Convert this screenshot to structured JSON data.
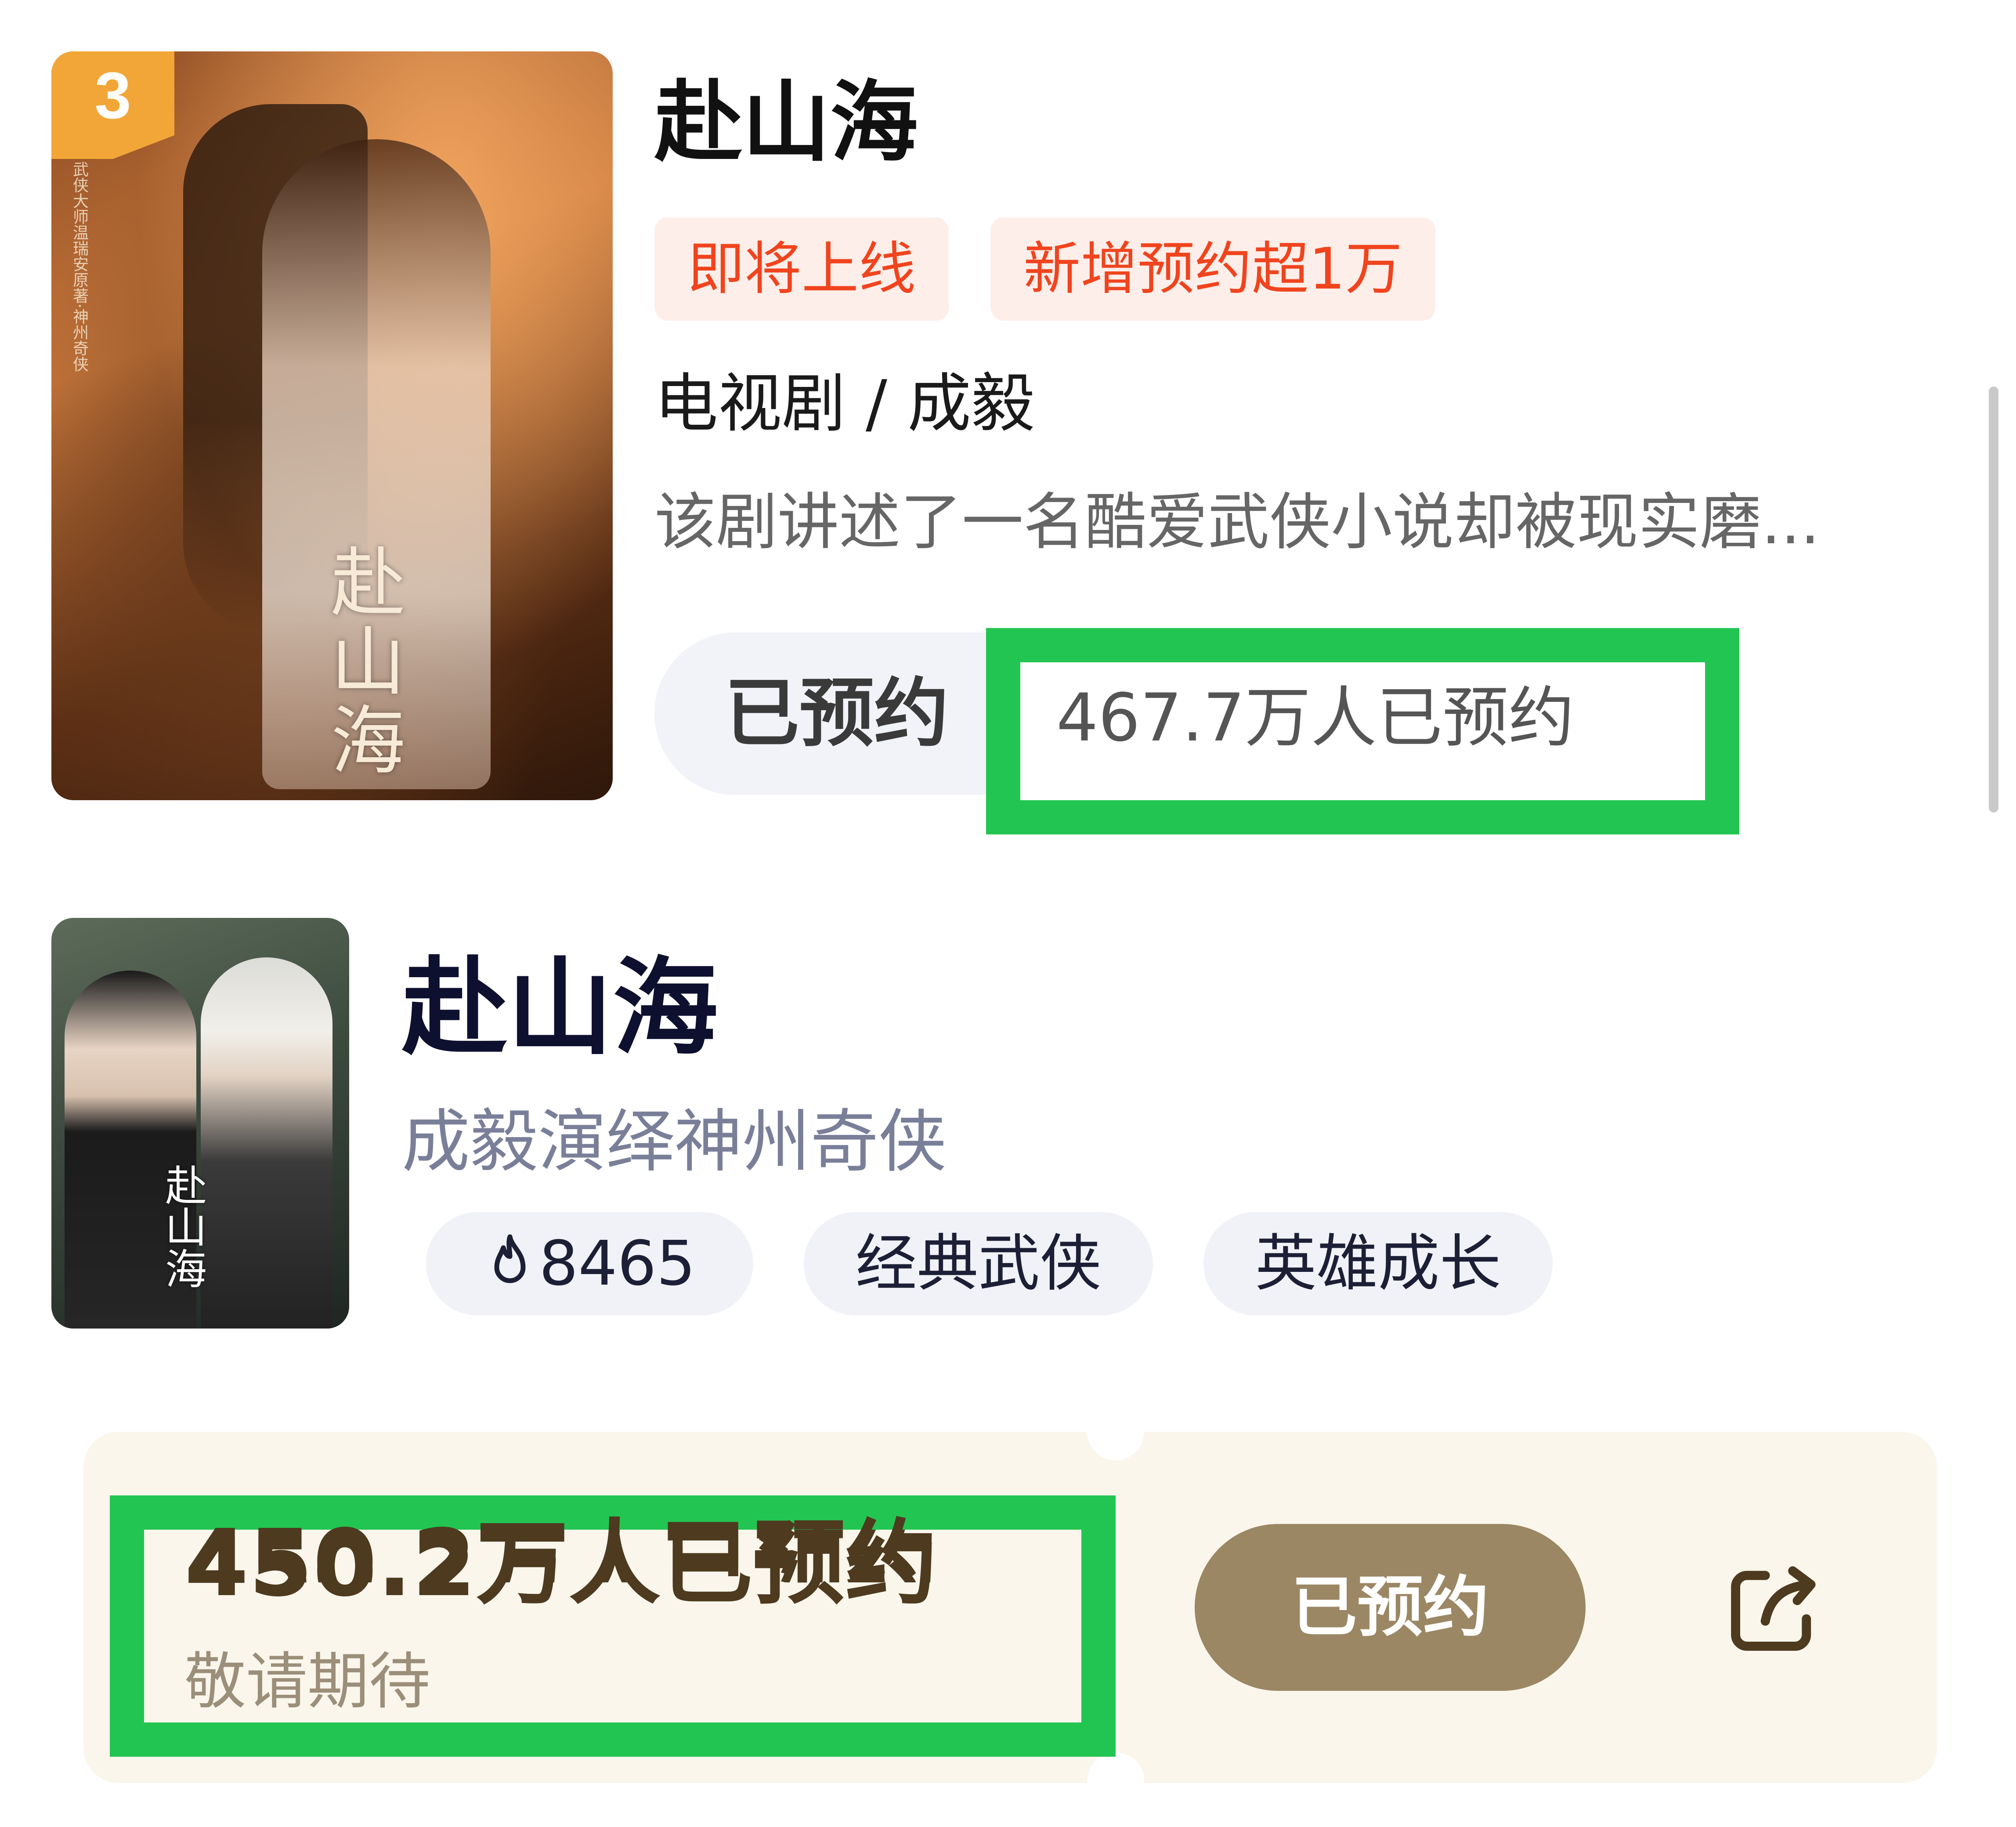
{
  "card1": {
    "rank": "3",
    "title": "赴山海",
    "tags": [
      "即将上线",
      "新增预约超1万"
    ],
    "meta": "电视剧 / 成毅",
    "description": "该剧讲述了一名酷爱武侠小说却被现实磨...",
    "reserve_button": "已预约",
    "reserve_count": "467.7万人已预约",
    "poster_calligraphy": "赴山海",
    "poster_side_text": "武侠大师温瑞安原著·神州奇侠"
  },
  "card2": {
    "title": "赴山海",
    "subtitle": "成毅演绎神州奇侠",
    "heat": "8465",
    "chips": [
      "经典武侠",
      "英雄成长"
    ],
    "poster_calligraphy": "赴山海"
  },
  "reservation_bar": {
    "count": "450.2万人已预约",
    "hint": "敬请期待",
    "button": "已预约",
    "share_icon": "share-icon"
  },
  "colors": {
    "highlight_box": "#23c552",
    "tag_text": "#f0441e",
    "tag_bg": "#fdeee9",
    "rank_badge": "#f2a637",
    "reserved_button_bg": "#9b8763",
    "reservation_bar_bg": "#fbf6ec"
  }
}
